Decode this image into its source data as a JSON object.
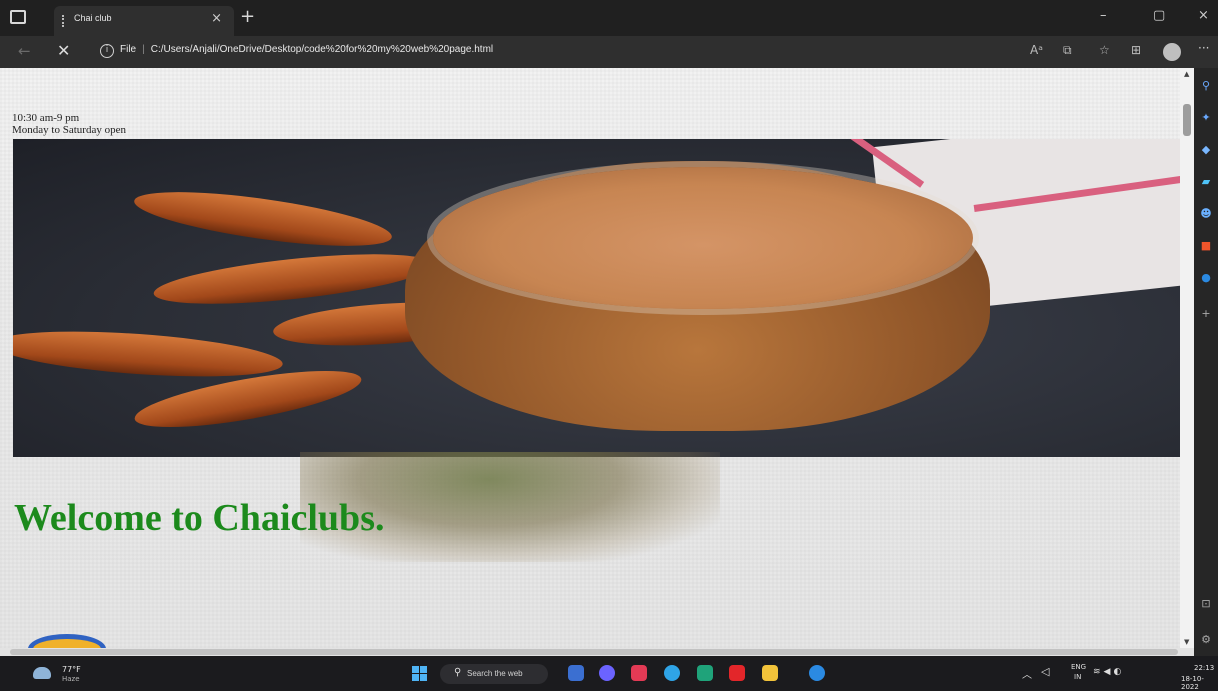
{
  "browser": {
    "tab_title": "Chai club",
    "tab_close": "×",
    "new_tab": "+",
    "window_controls": {
      "minimize": "–",
      "maximize": "▢",
      "close": "×"
    },
    "nav": {
      "back": "←",
      "stop": "✕"
    },
    "address": {
      "info": "i",
      "scheme_label": "File",
      "separator": "|",
      "path": "C:/Users/Anjali/OneDrive/Desktop/code%20for%20my%20web%20page.html"
    },
    "toolbar_icons": [
      "read-aloud-icon",
      "tab-actions-icon",
      "favorites-icon",
      "collections-icon",
      "profile-icon",
      "more-icon"
    ],
    "more": "···"
  },
  "page": {
    "hours": "10:30 am-9 pm",
    "days": "Monday to Saturday open",
    "welcome": "Welcome to Chaiclubs."
  },
  "sidebar": {
    "icons": [
      "search-icon",
      "copilot-icon",
      "shopping-tag-icon",
      "tools-icon",
      "people-icon",
      "office-icon",
      "outlook-icon",
      "add-icon",
      "split-screen-icon",
      "settings-icon"
    ]
  },
  "taskbar": {
    "weather_temp": "77°F",
    "weather_condition": "Haze",
    "search_placeholder": "Search the web",
    "language_top": "ENG",
    "language_bottom": "IN",
    "time": "22:13",
    "date": "18-10-2022",
    "app_colors": [
      "#3b6fd1",
      "#6b63ff",
      "#e33a55",
      "#2fa4e7",
      "#1fa37a",
      "#e3262a",
      "#f2c33a",
      "#2b8ae2"
    ]
  }
}
